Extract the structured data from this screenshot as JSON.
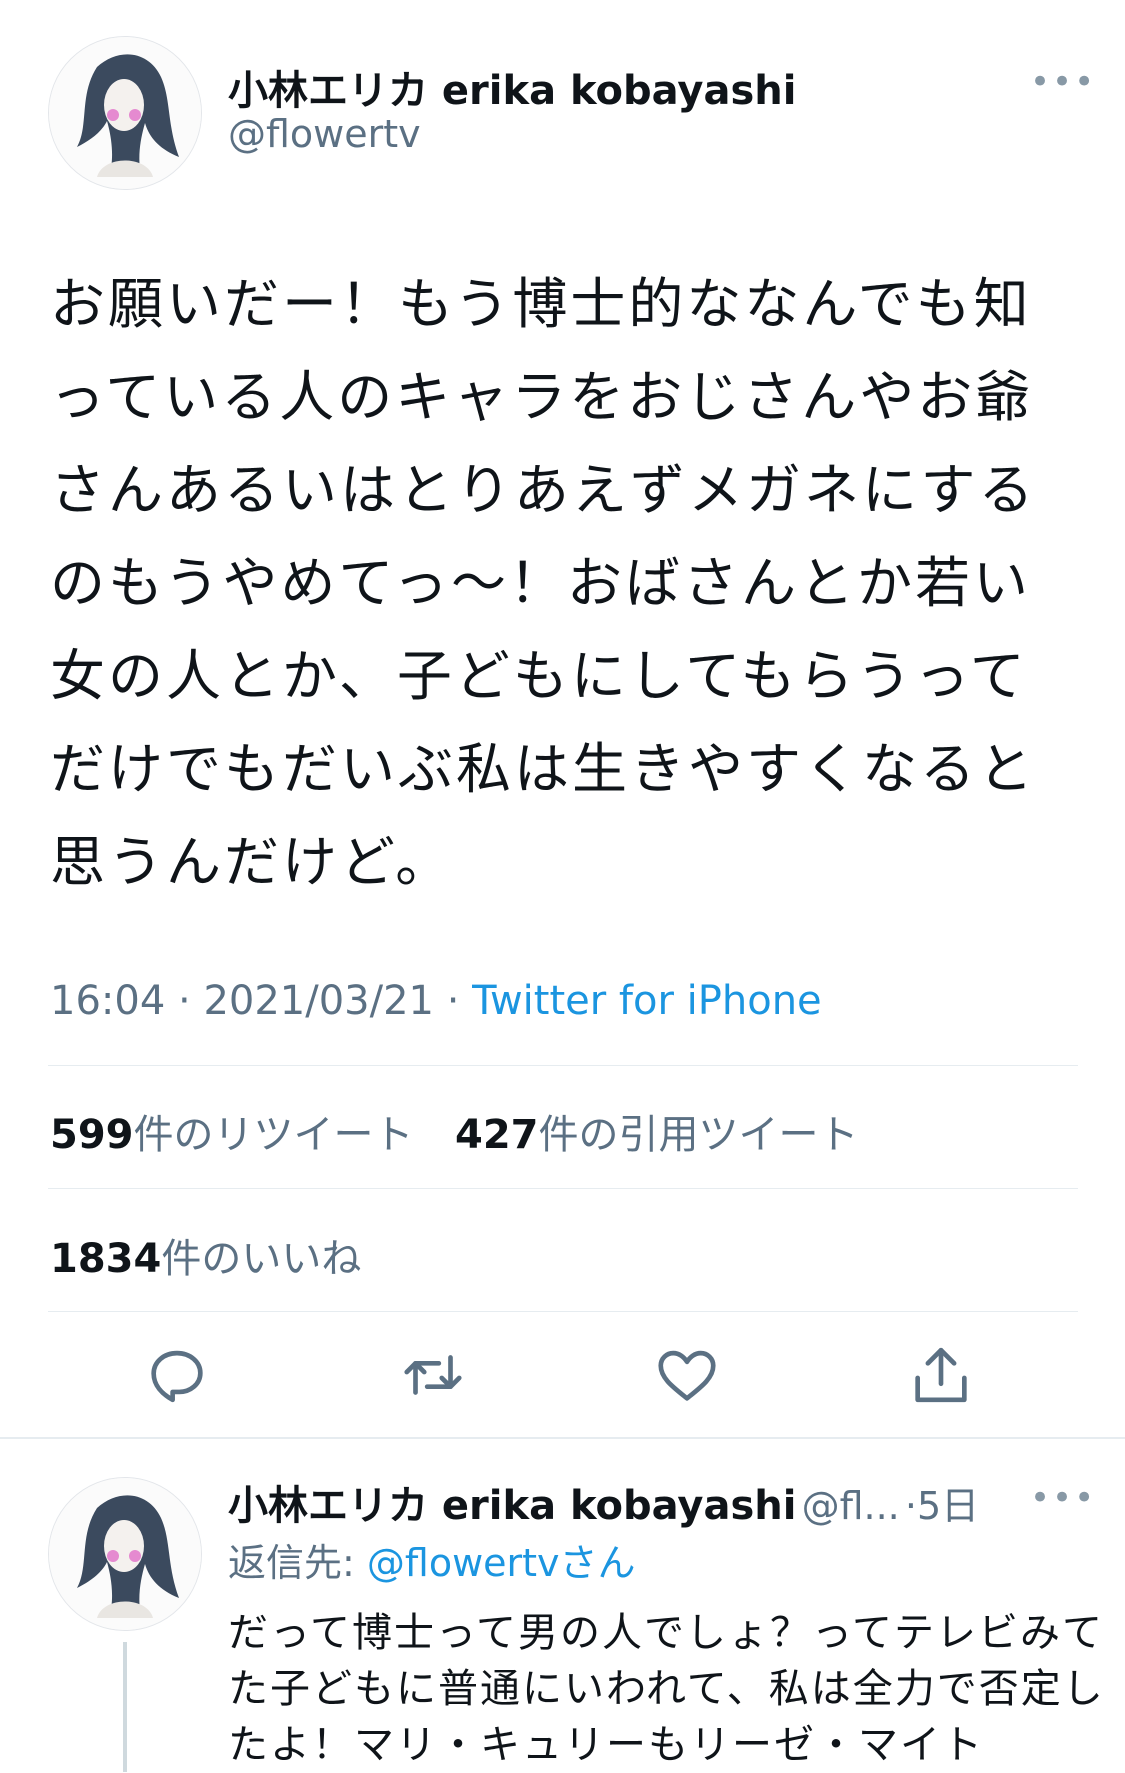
{
  "tweet": {
    "author_name": "小林エリカ erika kobayashi",
    "handle": "@flowertv",
    "more_icon": "more-icon",
    "text": "お願いだー！もう博士的ななんでも知っている人のキャラをおじさんやお爺さんあるいはとりあえずメガネにするのもうやめてっ〜！おばさんとか若い女の人とか、子どもにしてもらうってだけでもだいぶ私は生きやすくなると思うんだけど。",
    "time": "16:04",
    "date": "2021/03/21",
    "separator": " · ",
    "source": "Twitter for iPhone",
    "retweets_count": "599",
    "retweets_label": "件のリツイート",
    "quotes_count": "427",
    "quotes_label": "件の引用ツイート",
    "likes_count": "1834",
    "likes_label": "件のいいね"
  },
  "actions": [
    {
      "name": "reply-icon"
    },
    {
      "name": "retweet-icon"
    },
    {
      "name": "like-icon"
    },
    {
      "name": "share-icon"
    }
  ],
  "reply": {
    "author_name": "小林エリカ erika kobayashi",
    "handle_truncated": "@fl...",
    "age": "·5日",
    "reply_to_prefix": "返信先: ",
    "reply_to_handle": "@flowertvさん",
    "text": "だって博士って男の人でしょ？ってテレビみてた子どもに普通にいわれて、私は全力で否定したよ！マリ・キュリーもリーゼ・マイト"
  },
  "colors": {
    "text": "#0f1419",
    "secondary": "#5b7083",
    "link": "#1b95e0",
    "divider": "#e6ecf0"
  }
}
